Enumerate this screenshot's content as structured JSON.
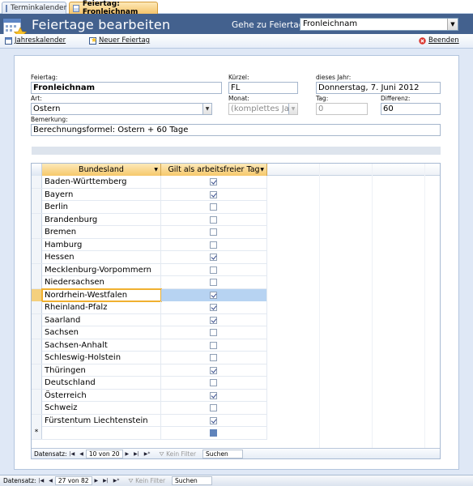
{
  "tabs": [
    {
      "label": "Terminkalender"
    },
    {
      "label": "Feiertag: Fronleichnam"
    }
  ],
  "header": {
    "title": "Feiertage bearbeiten",
    "goto_label": "Gehe zu Feiertag:",
    "goto_value": "Fronleichnam"
  },
  "toolbar": {
    "jahreskalender": "Jahreskalender",
    "neuer_feiertag": "Neuer Feiertag",
    "beenden": "Beenden"
  },
  "form": {
    "feiertag_label": "Feiertag:",
    "feiertag_value": "Fronleichnam",
    "kuerzel_label": "Kürzel:",
    "kuerzel_value": "FL",
    "dieses_jahr_label": "dieses Jahr:",
    "dieses_jahr_value": "Donnerstag, 7. Juni 2012",
    "art_label": "Art:",
    "art_value": "Ostern",
    "monat_label": "Monat:",
    "monat_value": "(komplettes Jahr)",
    "tag_label": "Tag:",
    "tag_value": "0",
    "differenz_label": "Differenz:",
    "differenz_value": "60",
    "bemerkung_label": "Bemerkung:",
    "bemerkung_value": "Berechnungsformel: Ostern + 60 Tage"
  },
  "grid": {
    "col_bundesland": "Bundesland",
    "col_arbeitsfrei": "Gilt als arbeitsfreier Tag",
    "rows": [
      {
        "name": "Baden-Württemberg",
        "checked": true
      },
      {
        "name": "Bayern",
        "checked": true
      },
      {
        "name": "Berlin",
        "checked": false
      },
      {
        "name": "Brandenburg",
        "checked": false
      },
      {
        "name": "Bremen",
        "checked": false
      },
      {
        "name": "Hamburg",
        "checked": false
      },
      {
        "name": "Hessen",
        "checked": true
      },
      {
        "name": "Mecklenburg-Vorpommern",
        "checked": false
      },
      {
        "name": "Niedersachsen",
        "checked": false
      },
      {
        "name": "Nordrhein-Westfalen",
        "checked": true
      },
      {
        "name": "Rheinland-Pfalz",
        "checked": true
      },
      {
        "name": "Saarland",
        "checked": true
      },
      {
        "name": "Sachsen",
        "checked": false
      },
      {
        "name": "Sachsen-Anhalt",
        "checked": false
      },
      {
        "name": "Schleswig-Holstein",
        "checked": false
      },
      {
        "name": "Thüringen",
        "checked": true
      },
      {
        "name": "Deutschland",
        "checked": false
      },
      {
        "name": "Österreich",
        "checked": true
      },
      {
        "name": "Schweiz",
        "checked": false
      },
      {
        "name": "Fürstentum Liechtenstein",
        "checked": true
      }
    ],
    "new_row_marker": "*",
    "active_row_name": "Nordrhein-Westfalen"
  },
  "subnav": {
    "label": "Datensatz:",
    "position": "10 von 20",
    "filter": "Kein Filter",
    "search": "Suchen"
  },
  "mainnav": {
    "label": "Datensatz:",
    "position": "27 von 82",
    "filter": "Kein Filter",
    "search": "Suchen"
  }
}
